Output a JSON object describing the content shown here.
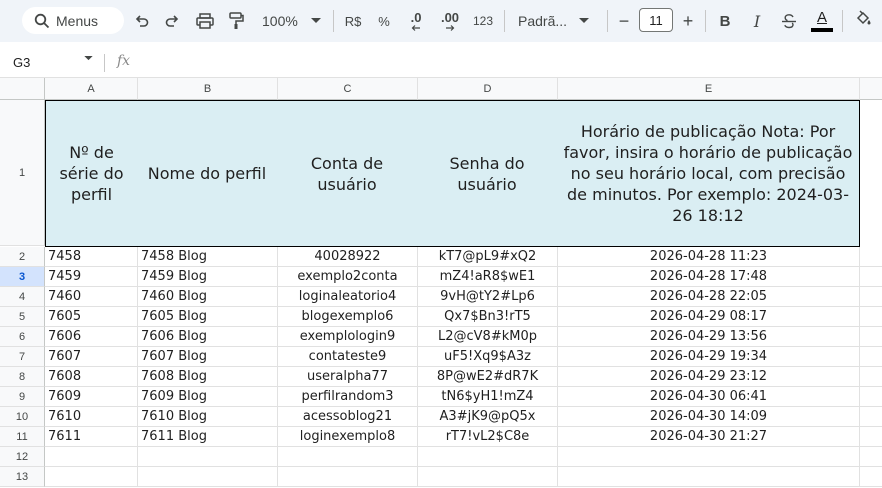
{
  "toolbar": {
    "search_label": "Menus",
    "zoom": "100%",
    "currency": "R$",
    "percent": "%",
    "decrease_decimal": ".0",
    "increase_decimal": ".00",
    "number_format": "123",
    "font_name": "Padrã...",
    "font_size": "11",
    "minus": "−",
    "plus": "+",
    "bold": "B",
    "italic": "I",
    "text_color_letter": "A"
  },
  "formula_bar": {
    "cell_ref": "G3",
    "fx": "fx",
    "content": ""
  },
  "columns": [
    "A",
    "B",
    "C",
    "D",
    "E"
  ],
  "row_numbers": [
    "1",
    "2",
    "3",
    "4",
    "5",
    "6",
    "7",
    "8",
    "9",
    "10",
    "11",
    "12",
    "13"
  ],
  "header_row": {
    "a": "Nº de série do perfil",
    "b": "Nome do perfil",
    "c": "Conta de usuário",
    "d": "Senha do usuário",
    "e": "Horário de publicação  Nota: Por favor, insira o horário de publicação no seu horário local, com precisão de minutos. Por exemplo: 2024-03-26 18:12"
  },
  "rows": [
    {
      "a": "7458",
      "b": "7458 Blog",
      "c": "40028922",
      "d": "kT7@pL9#xQ2",
      "e": "2026-04-28 11:23"
    },
    {
      "a": "7459",
      "b": "7459 Blog",
      "c": "exemplo2conta",
      "d": "mZ4!aR8$wE1",
      "e": "2026-04-28 17:48"
    },
    {
      "a": "7460",
      "b": "7460 Blog",
      "c": "loginaleatorio4",
      "d": "9vH@tY2#Lp6",
      "e": "2026-04-28 22:05"
    },
    {
      "a": "7605",
      "b": "7605 Blog",
      "c": "blogexemplo6",
      "d": "Qx7$Bn3!rT5",
      "e": "2026-04-29 08:17"
    },
    {
      "a": "7606",
      "b": "7606 Blog",
      "c": "exemplologin9",
      "d": "L2@cV8#kM0p",
      "e": "2026-04-29 13:56"
    },
    {
      "a": "7607",
      "b": "7607 Blog",
      "c": "contateste9",
      "d": "uF5!Xq9$A3z",
      "e": "2026-04-29 19:34"
    },
    {
      "a": "7608",
      "b": "7608 Blog",
      "c": "useralpha77",
      "d": "8P@wE2#dR7K",
      "e": "2026-04-29 23:12"
    },
    {
      "a": "7609",
      "b": "7609 Blog",
      "c": "perfilrandom3",
      "d": "tN6$yH1!mZ4",
      "e": "2026-04-30 06:41"
    },
    {
      "a": "7610",
      "b": "7610 Blog",
      "c": "acessoblog21",
      "d": "A3#jK9@pQ5x",
      "e": "2026-04-30 14:09"
    },
    {
      "a": "7611",
      "b": "7611 Blog",
      "c": "loginexemplo8",
      "d": "rT7!vL2$C8e",
      "e": "2026-04-30 21:27"
    }
  ],
  "selected_row": "3",
  "colors": {
    "header_fill": "#daeef3",
    "toolbar_bg": "#f0f4f9",
    "selection": "#d3e3fd"
  },
  "icons": [
    "search-icon",
    "undo-icon",
    "redo-icon",
    "print-icon",
    "paint-format-icon",
    "zoom-dropdown-icon",
    "font-dropdown-icon",
    "strikethrough-icon",
    "text-color-icon",
    "fill-color-icon"
  ]
}
